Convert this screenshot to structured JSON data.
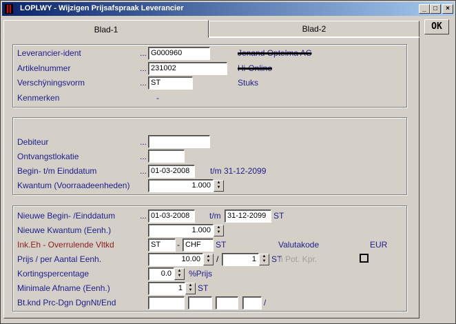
{
  "window": {
    "title": "LOPLWY - Wijzigen Prijsafspraak Leverancier",
    "btn_minimize": "_",
    "btn_maximize": "□",
    "btn_close": "×"
  },
  "toolbar": {
    "ok_label": "OK"
  },
  "tabs": [
    {
      "label": "Blad-1",
      "active": true
    },
    {
      "label": "Blad-2",
      "active": false
    }
  ],
  "leader": "...",
  "group1": {
    "leverancier_label": "Leverancier-ident",
    "leverancier_value": "G000960",
    "leverancier_name": "Jenand Optelma AC",
    "artikel_label": "Artikelnummer",
    "artikel_value": "231002",
    "artikel_name": "Hi-Online",
    "verschijning_label": "Verschÿningsvorm",
    "verschijning_value": "ST",
    "verschijning_desc": "Stuks",
    "kenmerken_label": "Kenmerken",
    "kenmerken_value": "-"
  },
  "group2": {
    "debiteur_label": "Debiteur",
    "debiteur_value": "",
    "ontvangst_label": "Ontvangstlokatie",
    "ontvangst_value": "",
    "begin_label": "Begin- t/m Einddatum",
    "begin_value": "01-03-2008",
    "eind_text": "t/m 31-12-2099",
    "kwantum_label": "Kwantum (Voorraadeenheden)",
    "kwantum_value": "1.000"
  },
  "group3": {
    "nieuwe_begin_label": "Nieuwe Begin- /Einddatum",
    "nieuwe_begin_value": "01-03-2008",
    "tm_label": "t/m",
    "nieuwe_eind_value": "31-12-2099",
    "nieuwe_begin_unit": "ST",
    "nieuwe_kwantum_label": "Nieuwe Kwantum (Eenh.)",
    "nieuwe_kwantum_value": "1.000",
    "inkeh_label": "Ink.Eh - Overrulende Vltkd",
    "inkeh_value": "ST",
    "inkeh_sep": "-",
    "vltkd_value": "CHF",
    "inkeh_unit": "ST",
    "valutakode_label": "Valutakode",
    "valutakode_value": "EUR",
    "prijs_label": "Prijs / per Aantal Eenh.",
    "prijs_value": "10.00",
    "prijs_sep": "/",
    "aantal_value": "1",
    "prijs_unit": "ST",
    "pot_kpr_label": "n Pot. Kpr.",
    "korting_label": "Kortingspercentage",
    "korting_value": "0.0",
    "korting_unit": "%Prijs",
    "minafname_label": "Minimale Afname (Eenh.)",
    "minafname_value": "1",
    "minafname_unit": "ST",
    "btknd_label": "Bt.knd Prc-Dgn DgnNt/End",
    "btknd_values": [
      "",
      "",
      "",
      ""
    ],
    "btknd_sep": "/"
  }
}
